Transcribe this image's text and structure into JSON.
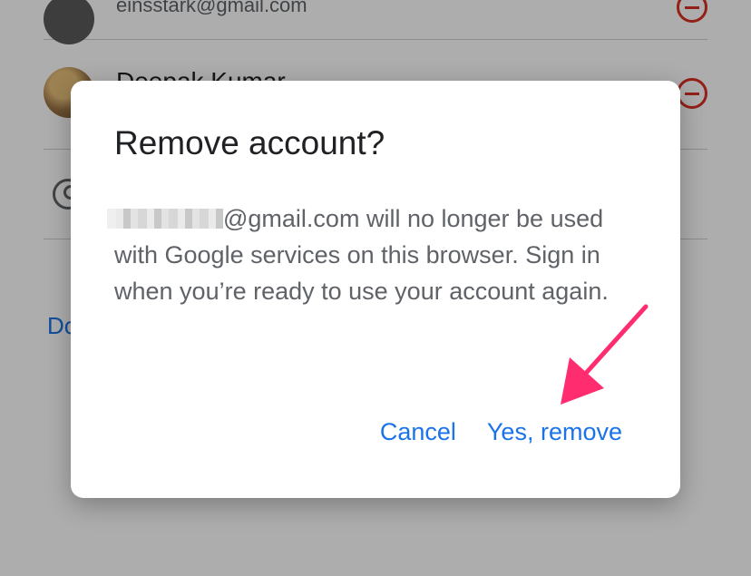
{
  "background": {
    "accounts": [
      {
        "name": "",
        "email": "einsstark@gmail.com"
      },
      {
        "name": "Deepak Kumar",
        "email": ""
      }
    ],
    "done_label": "Do"
  },
  "dialog": {
    "title": "Remove account?",
    "body_email_suffix": "@gmail.com",
    "body_text": " will no longer be used with Google services on this browser. Sign in when you’re ready to use your account again.",
    "cancel_label": "Cancel",
    "confirm_label": "Yes, remove"
  },
  "colors": {
    "accent": "#1a73e8",
    "danger": "#d93025",
    "annotation_arrow": "#ff2d6f"
  },
  "icons": {
    "remove": "remove-circle-icon",
    "person": "account-circle-icon",
    "arrow": "annotation-arrow-icon"
  }
}
